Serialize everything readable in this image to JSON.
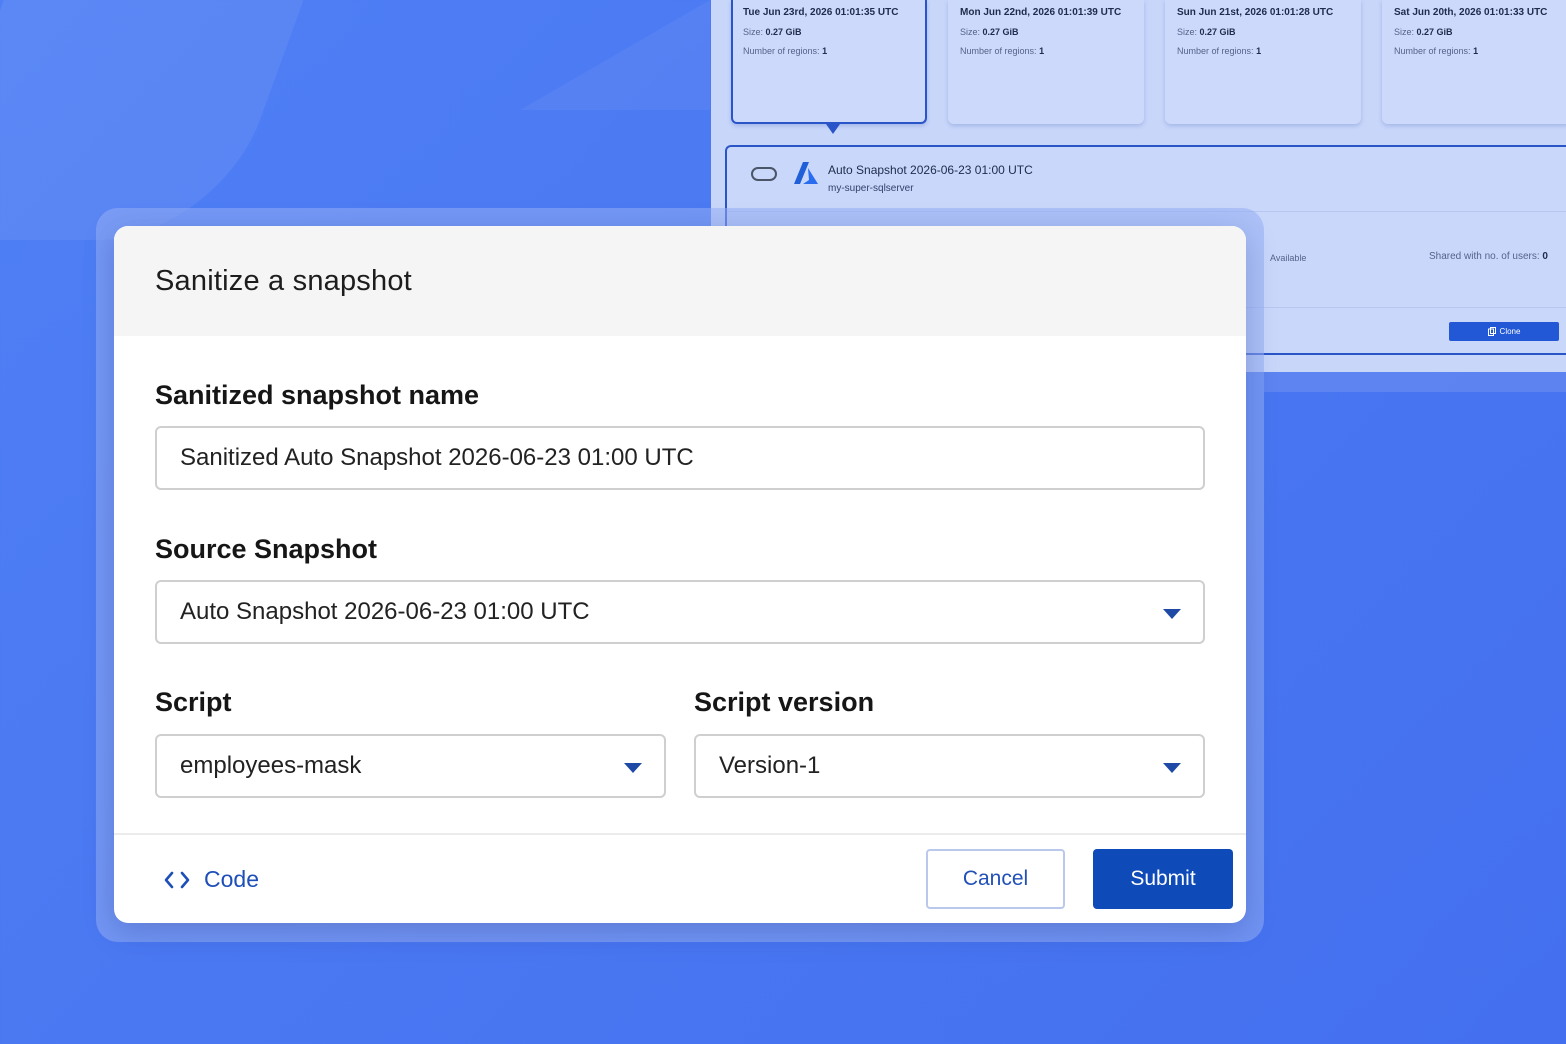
{
  "background": {
    "snapshot_cards": [
      {
        "date": "Tue Jun 23rd, 2026 01:01:35 UTC",
        "size_label": "Size:",
        "size": "0.27 GiB",
        "regions_label": "Number of regions:",
        "regions": "1",
        "selected": true
      },
      {
        "date": "Mon Jun 22nd, 2026 01:01:39 UTC",
        "size_label": "Size:",
        "size": "0.27 GiB",
        "regions_label": "Number of regions:",
        "regions": "1",
        "selected": false
      },
      {
        "date": "Sun Jun 21st, 2026 01:01:28 UTC",
        "size_label": "Size:",
        "size": "0.27 GiB",
        "regions_label": "Number of regions:",
        "regions": "1",
        "selected": false
      },
      {
        "date": "Sat Jun 20th, 2026 01:01:33 UTC",
        "size_label": "Size:",
        "size": "0.27 GiB",
        "regions_label": "Number of regions:",
        "regions": "1",
        "selected": false
      }
    ],
    "detail": {
      "title": "Auto Snapshot 2026-06-23 01:00 UTC",
      "server": "my-super-sqlserver",
      "status": "Available",
      "shared_label": "Shared with no. of users:",
      "shared_count": "0",
      "clone_label": "Clone",
      "db_icon": "database-icon",
      "cloud_icon": "azure-icon"
    }
  },
  "modal": {
    "title": "Sanitize a snapshot",
    "name_field": {
      "label": "Sanitized snapshot name",
      "value": "Sanitized Auto Snapshot 2026-06-23 01:00 UTC"
    },
    "source_field": {
      "label": "Source Snapshot",
      "value": "Auto Snapshot 2026-06-23 01:00 UTC"
    },
    "script_field": {
      "label": "Script",
      "value": "employees-mask"
    },
    "version_field": {
      "label": "Script version",
      "value": "Version-1"
    },
    "footer": {
      "code_label": "Code",
      "code_icon": "code-brackets-icon",
      "cancel_label": "Cancel",
      "submit_label": "Submit"
    }
  },
  "colors": {
    "background": "#4f7ff5",
    "primary": "#0e4bb9",
    "link": "#1e4fb8",
    "selected_border": "#2a55c9"
  }
}
